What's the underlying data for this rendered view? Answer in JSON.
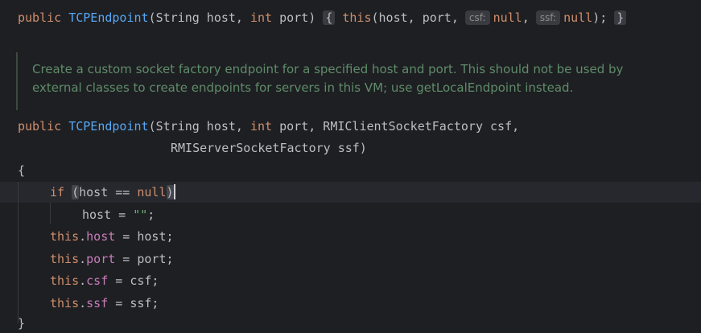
{
  "editor": {
    "line1": {
      "modifier": "public",
      "name": "TCPEndpoint",
      "params": "(String host, ",
      "int_kw": "int",
      "port": " port)",
      "fold_open": "{",
      "this_kw": "this",
      "args": "(host, port,",
      "csf_hint": "csf:",
      "null1": "null",
      "comma": ",",
      "ssf_hint": "ssf:",
      "null2": "null",
      "end": ");",
      "fold_close": "}"
    },
    "doc": "Create a custom socket factory endpoint for a specified host and port. This should not be used by external classes to create endpoints for servers in this VM; use getLocalEndpoint instead.",
    "sig1": {
      "modifier": "public",
      "name": "TCPEndpoint",
      "params_a": "(String host, ",
      "int_kw": "int",
      "params_b": " port, RMIClientSocketFactory csf,"
    },
    "sig2": "RMIServerSocketFactory ssf)",
    "open_brace": "{",
    "if_line": {
      "if_kw": "if",
      "open_paren": "(",
      "cond": "host == ",
      "null_kw": "null",
      "close_paren": ")"
    },
    "assign_host": {
      "lhs": "host = ",
      "value": "\"\"",
      "semi": ";"
    },
    "assignments": [
      {
        "this_kw": "this",
        "dot": ".",
        "field": "host",
        "rest": " = host;"
      },
      {
        "this_kw": "this",
        "dot": ".",
        "field": "port",
        "rest": " = port;"
      },
      {
        "this_kw": "this",
        "dot": ".",
        "field": "csf",
        "rest": " = csf;"
      },
      {
        "this_kw": "this",
        "dot": ".",
        "field": "ssf",
        "rest": " = ssf;"
      }
    ],
    "close_brace": "}"
  }
}
